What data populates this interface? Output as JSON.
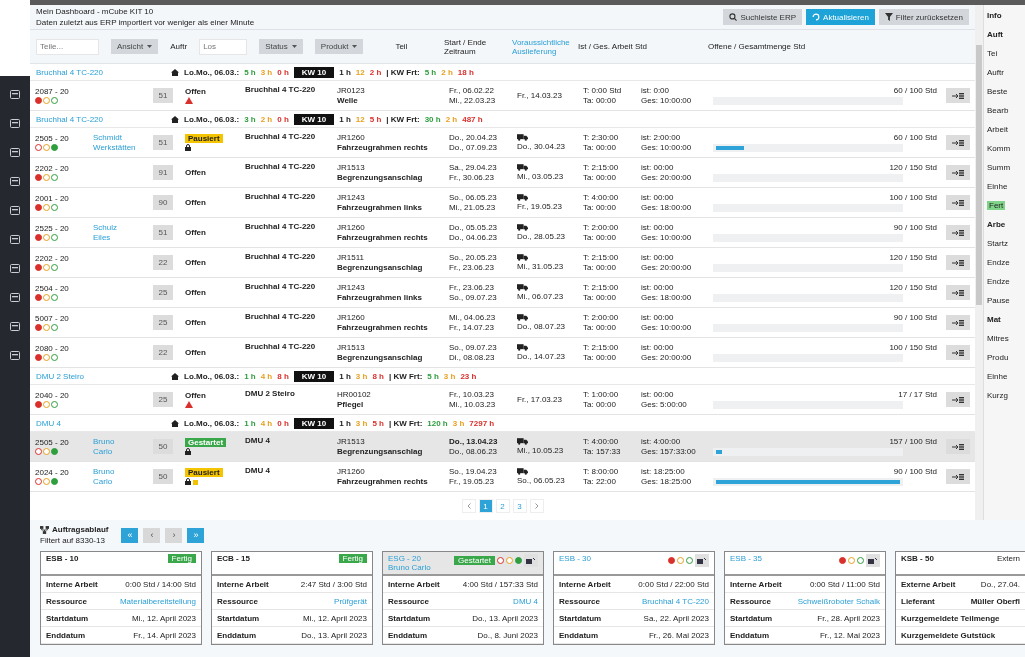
{
  "header": {
    "title": "Mein Dashboard - mCube KIT 10",
    "subtitle": "Daten zuletzt aus ERP importiert vor weniger als einer Minute",
    "buttons": [
      {
        "label": "Suchleiste ERP",
        "kind": "search"
      },
      {
        "label": "Aktualisieren",
        "kind": "primary"
      },
      {
        "label": "Filter zurücksetzen",
        "kind": "filter"
      }
    ]
  },
  "filters": {
    "part": {
      "placeholder": "Teile..."
    },
    "view": "Ansicht",
    "order_label": "Auftr",
    "lot": {
      "placeholder": "Los"
    },
    "status": "Status",
    "product": "Produkt",
    "part_label": "Teil"
  },
  "columns": [
    {
      "label": "Start / Ende Zeitraum",
      "link": false
    },
    {
      "label": "Voraussichtliche Auslieferung",
      "link": true
    },
    {
      "label": "Ist / Ges. Arbeit Std",
      "link": false
    },
    {
      "label": "Offene / Gesamtmenge Std",
      "link": false
    }
  ],
  "groups": [
    {
      "name": "Bruchhal 4 TC-220",
      "segments": [
        {
          "text": "Lo.Mo., 06.03.:",
          "kind": "text"
        },
        {
          "text": "5 h",
          "kind": "ok"
        },
        {
          "text": "3 h",
          "kind": "warn"
        },
        {
          "text": "0 h",
          "kind": "late"
        },
        {
          "text": "KW 10",
          "kind": "chip"
        },
        {
          "text": "1 h",
          "kind": "text"
        },
        {
          "text": "12",
          "kind": "warn"
        },
        {
          "text": "2 h",
          "kind": "late"
        },
        {
          "text": "| KW Frt:",
          "kind": "text"
        },
        {
          "text": "5 h",
          "kind": "ok"
        },
        {
          "text": "2 h",
          "kind": "warn"
        },
        {
          "text": "18 h",
          "kind": "late"
        }
      ],
      "rows": [
        {
          "order": "2087 - 20",
          "lights": [
            {
              "kind": "red",
              "on": true
            },
            {
              "kind": "amber",
              "on": false
            },
            {
              "kind": "green",
              "on": false
            }
          ],
          "qty": "51",
          "status": {
            "kind": "open",
            "text": "Offen"
          },
          "alert": {
            "kind": "warning"
          },
          "machine": "Bruchhal 4 TC-220",
          "code": "JR0123",
          "article": "Welle",
          "start": "Fr., 06.02.22",
          "end": "Mi., 22.03.23",
          "truck": false,
          "delivery": "Fr., 14.03.23",
          "work": [
            "T: 0:00 Std",
            "Ta: 00:00"
          ],
          "qty_time": [
            "ist: 0:00",
            "Ges: 10:00:00"
          ],
          "level": 0,
          "hours": "60 / 100 Std",
          "selected": false
        }
      ]
    },
    {
      "name": "Bruchhal 4 TC-220",
      "segments": [
        {
          "text": "Lo.Mo., 06.03.:",
          "kind": "text"
        },
        {
          "text": "3 h",
          "kind": "ok"
        },
        {
          "text": "2 h",
          "kind": "warn"
        },
        {
          "text": "0 h",
          "kind": "late"
        },
        {
          "text": "KW 10",
          "kind": "chip"
        },
        {
          "text": "1 h",
          "kind": "text"
        },
        {
          "text": "12",
          "kind": "warn"
        },
        {
          "text": "5 h",
          "kind": "late"
        },
        {
          "text": "| KW Frt:",
          "kind": "text"
        },
        {
          "text": "30 h",
          "kind": "ok"
        },
        {
          "text": "2 h",
          "kind": "warn"
        },
        {
          "text": "487 h",
          "kind": "late"
        }
      ],
      "rows": [
        {
          "order": "2505 - 20",
          "lights": [
            {
              "kind": "red",
              "on": false
            },
            {
              "kind": "amber",
              "on": false
            },
            {
              "kind": "green",
              "on": true
            }
          ],
          "customer": [
            "Schmidt",
            "Werkstätten"
          ],
          "qty": "51",
          "status": {
            "kind": "paused",
            "text": "Pausiert"
          },
          "alert": {
            "kind": "lock"
          },
          "machine": "Bruchhal 4 TC-220",
          "code": "JR1260",
          "article": "Fahrzeugrahmen rechts",
          "start": "Do., 20.04.23",
          "end": "Do., 07.09.23",
          "truck": true,
          "delivery": "Do., 30.04.23",
          "work": [
            "T: 2:30:00",
            "Ta: 00:00"
          ],
          "qty_time": [
            "ist: 2:00:00",
            "Ges: 10:00:00"
          ],
          "level": 0.15,
          "hours": "60 / 100 Std",
          "selected": false
        },
        {
          "order": "2202 - 20",
          "lights": [
            {
              "kind": "red",
              "on": true
            },
            {
              "kind": "amber",
              "on": false
            },
            {
              "kind": "green",
              "on": false
            }
          ],
          "qty": "91",
          "status": {
            "kind": "open",
            "text": "Offen"
          },
          "machine": "Bruchhal 4 TC-220",
          "code": "JR1513",
          "article": "Begrenzungsanschlag",
          "start": "Sa., 29.04.23",
          "end": "Fr., 30.06.23",
          "truck": true,
          "delivery": "Mi., 03.05.23",
          "work": [
            "T: 2:15:00",
            "Ta: 00:00"
          ],
          "qty_time": [
            "ist: 00:00",
            "Ges: 20:00:00"
          ],
          "level": 0,
          "hours": "120 / 150 Std",
          "selected": false
        },
        {
          "order": "2001 - 20",
          "lights": [
            {
              "kind": "red",
              "on": true
            },
            {
              "kind": "amber",
              "on": false
            },
            {
              "kind": "green",
              "on": false
            }
          ],
          "qty": "90",
          "status": {
            "kind": "open",
            "text": "Offen"
          },
          "machine": "Bruchhal 4 TC-220",
          "code": "JR1243",
          "article": "Fahrzeugrahmen links",
          "start": "So., 06.05.23",
          "end": "Mi., 21.05.23",
          "truck": true,
          "delivery": "Fr., 19.05.23",
          "work": [
            "T: 4:00:00",
            "Ta: 00:00"
          ],
          "qty_time": [
            "ist: 00:00",
            "Ges: 18:00:00"
          ],
          "level": 0,
          "hours": "100 / 100 Std",
          "selected": false
        },
        {
          "order": "2525 - 20",
          "lights": [
            {
              "kind": "red",
              "on": true
            },
            {
              "kind": "amber",
              "on": false
            },
            {
              "kind": "green",
              "on": false
            }
          ],
          "customer": [
            "Schulz",
            "Eiles"
          ],
          "qty": "51",
          "status": {
            "kind": "open",
            "text": "Offen"
          },
          "machine": "Bruchhal 4 TC-220",
          "code": "JR1260",
          "article": "Fahrzeugrahmen rechts",
          "start": "Do., 05.05.23",
          "end": "Do., 04.06.23",
          "truck": true,
          "delivery": "Do., 28.05.23",
          "work": [
            "T: 2:00:00",
            "Ta: 00:00"
          ],
          "qty_time": [
            "ist: 00:00",
            "Ges: 10:00:00"
          ],
          "level": 0,
          "hours": "90 / 100 Std",
          "selected": false
        },
        {
          "order": "2202 - 20",
          "lights": [
            {
              "kind": "red",
              "on": true
            },
            {
              "kind": "amber",
              "on": false
            },
            {
              "kind": "green",
              "on": false
            }
          ],
          "qty": "22",
          "status": {
            "kind": "open",
            "text": "Offen"
          },
          "machine": "Bruchhal 4 TC-220",
          "code": "JR1511",
          "article": "Begrenzungsanschlag",
          "start": "So., 20.05.23",
          "end": "Fr., 23.06.23",
          "truck": true,
          "delivery": "Mi., 31.05.23",
          "work": [
            "T: 2:15:00",
            "Ta: 00:00"
          ],
          "qty_time": [
            "ist: 00:00",
            "Ges: 20:00:00"
          ],
          "level": 0,
          "hours": "120 / 150 Std",
          "selected": false
        },
        {
          "order": "2504 - 20",
          "lights": [
            {
              "kind": "red",
              "on": true
            },
            {
              "kind": "amber",
              "on": false
            },
            {
              "kind": "green",
              "on": false
            }
          ],
          "qty": "25",
          "status": {
            "kind": "open",
            "text": "Offen"
          },
          "machine": "Bruchhal 4 TC-220",
          "code": "JR1243",
          "article": "Fahrzeugrahmen links",
          "start": "Fr., 23.06.23",
          "end": "So., 09.07.23",
          "truck": true,
          "delivery": "Mi., 06.07.23",
          "work": [
            "T: 2:15:00",
            "Ta: 00:00"
          ],
          "qty_time": [
            "ist: 00:00",
            "Ges: 18:00:00"
          ],
          "level": 0,
          "hours": "120 / 150 Std",
          "selected": false
        },
        {
          "order": "5007 - 20",
          "lights": [
            {
              "kind": "red",
              "on": true
            },
            {
              "kind": "amber",
              "on": false
            },
            {
              "kind": "green",
              "on": false
            }
          ],
          "qty": "25",
          "status": {
            "kind": "open",
            "text": "Offen"
          },
          "machine": "Bruchhal 4 TC-220",
          "code": "JR1260",
          "article": "Fahrzeugrahmen rechts",
          "start": "Mi., 04.06.23",
          "end": "Fr., 14.07.23",
          "truck": true,
          "delivery": "Do., 08.07.23",
          "work": [
            "T: 2:00:00",
            "Ta: 00:00"
          ],
          "qty_time": [
            "ist: 00:00",
            "Ges: 10:00:00"
          ],
          "level": 0,
          "hours": "90 / 100 Std",
          "selected": false
        },
        {
          "order": "2080 - 20",
          "lights": [
            {
              "kind": "red",
              "on": true
            },
            {
              "kind": "amber",
              "on": false
            },
            {
              "kind": "green",
              "on": false
            }
          ],
          "qty": "22",
          "status": {
            "kind": "open",
            "text": "Offen"
          },
          "machine": "Bruchhal 4 TC-220",
          "code": "JR1513",
          "article": "Begrenzungsanschlag",
          "start": "So., 09.07.23",
          "end": "Di., 08.08.23",
          "truck": true,
          "delivery": "Do., 14.07.23",
          "work": [
            "T: 2:15:00",
            "Ta: 00:00"
          ],
          "qty_time": [
            "ist: 00:00",
            "Ges: 20:00:00"
          ],
          "level": 0,
          "hours": "100 / 150 Std",
          "selected": false
        }
      ]
    },
    {
      "name": "DMU 2 Steiro",
      "segments": [
        {
          "text": "Lo.Mo., 06.03.:",
          "kind": "text"
        },
        {
          "text": "1 h",
          "kind": "ok"
        },
        {
          "text": "4 h",
          "kind": "warn"
        },
        {
          "text": "8 h",
          "kind": "late"
        },
        {
          "text": "KW 10",
          "kind": "chip"
        },
        {
          "text": "1 h",
          "kind": "text"
        },
        {
          "text": "3 h",
          "kind": "warn"
        },
        {
          "text": "8 h",
          "kind": "late"
        },
        {
          "text": "| KW Frt:",
          "kind": "text"
        },
        {
          "text": "5 h",
          "kind": "ok"
        },
        {
          "text": "3 h",
          "kind": "warn"
        },
        {
          "text": "23 h",
          "kind": "late"
        }
      ],
      "rows": [
        {
          "order": "2040 - 20",
          "lights": [
            {
              "kind": "red",
              "on": true
            },
            {
              "kind": "amber",
              "on": false
            },
            {
              "kind": "green",
              "on": false
            }
          ],
          "qty": "25",
          "status": {
            "kind": "open",
            "text": "Offen"
          },
          "alert": {
            "kind": "warning"
          },
          "machine": "DMU 2 Steiro",
          "code": "HR00102",
          "article": "Pflegel",
          "start": "Fr., 10.03.23",
          "end": "Mi., 10.03.23",
          "truck": false,
          "delivery": "Fr., 17.03.23",
          "work": [
            "T: 1:00:00",
            "Ta: 00:00"
          ],
          "qty_time": [
            "ist: 00:00",
            "Ges: 5:00:00"
          ],
          "level": 0,
          "hours": "17 / 17 Std",
          "selected": false
        }
      ]
    },
    {
      "name": "DMU 4",
      "segments": [
        {
          "text": "Lo.Mo., 06.03.:",
          "kind": "text"
        },
        {
          "text": "1 h",
          "kind": "ok"
        },
        {
          "text": "4 h",
          "kind": "warn"
        },
        {
          "text": "0 h",
          "kind": "late"
        },
        {
          "text": "KW 10",
          "kind": "chip"
        },
        {
          "text": "1 h",
          "kind": "text"
        },
        {
          "text": "3 h",
          "kind": "warn"
        },
        {
          "text": "5 h",
          "kind": "late"
        },
        {
          "text": "| KW Frt:",
          "kind": "text"
        },
        {
          "text": "120 h",
          "kind": "ok"
        },
        {
          "text": "3 h",
          "kind": "warn"
        },
        {
          "text": "7297 h",
          "kind": "late"
        }
      ],
      "rows": [
        {
          "order": "2505 - 20",
          "lights": [
            {
              "kind": "red",
              "on": false
            },
            {
              "kind": "amber",
              "on": false
            },
            {
              "kind": "green",
              "on": true
            }
          ],
          "customer": [
            "Bruno",
            "Carlo"
          ],
          "qty": "50",
          "status": {
            "kind": "started",
            "text": "Gestartet"
          },
          "alert": {
            "kind": "lock"
          },
          "machine": "DMU 4",
          "code": "JR1513",
          "article": "Begrenzungsanschlag",
          "start": "Do., 13.04.23",
          "end": "Do., 08.06.23",
          "truck": true,
          "delivery": "Mi., 10.05.23",
          "work": [
            "T: 4:00:00",
            "Ta: 157:33"
          ],
          "qty_time": [
            "ist: 4:00:00",
            "Ges: 157:33:00"
          ],
          "level": 0.03,
          "hours": "157 / 100 Std",
          "selected": true
        },
        {
          "order": "2024 - 20",
          "lights": [
            {
              "kind": "red",
              "on": false
            },
            {
              "kind": "amber",
              "on": false
            },
            {
              "kind": "green",
              "on": true
            }
          ],
          "customer": [
            "Bruno",
            "Carlo"
          ],
          "qty": "50",
          "status": {
            "kind": "paused",
            "text": "Pausiert"
          },
          "alert": {
            "kind": "lock-flag"
          },
          "machine": "DMU 4",
          "code": "JR1260",
          "article": "Fahrzeugrahmen rechts",
          "start": "So., 19.04.23",
          "end": "Fr., 19.05.23",
          "truck": true,
          "delivery": "So., 06.05.23",
          "work": [
            "T: 8:00:00",
            "Ta: 22:00"
          ],
          "qty_time": [
            "ist: 18:25:00",
            "Ges: 18:25:00"
          ],
          "level": 1,
          "hours": "90 / 100 Std",
          "selected": false
        }
      ]
    }
  ],
  "pagination": {
    "pages": [
      {
        "label": "1",
        "selected": true
      },
      {
        "label": "2",
        "selected": false
      },
      {
        "label": "3",
        "selected": false
      }
    ]
  },
  "side_panel": {
    "items": [
      {
        "kind": "heading",
        "text": "Info"
      },
      {
        "kind": "heading",
        "text": "Auft"
      },
      {
        "kind": "label",
        "text": "Tei"
      },
      {
        "kind": "label",
        "text": "Auftr"
      },
      {
        "kind": "label",
        "text": "Beste"
      },
      {
        "kind": "label",
        "text": "Bearb"
      },
      {
        "kind": "label",
        "text": "Arbeit"
      },
      {
        "kind": "label",
        "text": "Komm"
      },
      {
        "kind": "label",
        "text": "Summ"
      },
      {
        "kind": "label",
        "text": "Einhe"
      },
      {
        "kind": "badge",
        "text": "Fert"
      },
      {
        "kind": "heading",
        "text": "Arbe"
      },
      {
        "kind": "label",
        "text": "Startz"
      },
      {
        "kind": "label",
        "text": "Endze"
      },
      {
        "kind": "label",
        "text": "Endze"
      },
      {
        "kind": "label",
        "text": "Pause"
      },
      {
        "kind": "heading",
        "text": "Mat"
      },
      {
        "kind": "label",
        "text": "Mitres"
      },
      {
        "kind": "label",
        "text": "Produ"
      },
      {
        "kind": "label",
        "text": "Einhe"
      },
      {
        "kind": "label",
        "text": "Kurzg"
      }
    ]
  },
  "flow": {
    "title": "Auftragsablauf",
    "subtitle": "Filtert auf 8330-13",
    "buttons": [
      {
        "label": "«",
        "kind": "primary"
      },
      {
        "label": "‹",
        "kind": "plain"
      },
      {
        "label": "›",
        "kind": "plain"
      },
      {
        "label": "»",
        "kind": "primary"
      }
    ],
    "cards": [
      {
        "title": "ESB - 10",
        "link": false,
        "badge": "Fertig",
        "action": false,
        "highlight": false,
        "rows": [
          {
            "label": "Interne Arbeit",
            "value": "0:00 Std / 14:00 Std"
          },
          {
            "label": "Ressource",
            "value": "Materialbereitstellung",
            "link": true
          },
          {
            "label": "Startdatum",
            "value": "Mi., 12. April 2023"
          },
          {
            "label": "Enddatum",
            "value": "Fr., 14. April 2023"
          }
        ]
      },
      {
        "title": "ECB - 15",
        "link": false,
        "badge": "Fertig",
        "action": false,
        "highlight": false,
        "rows": [
          {
            "label": "Interne Arbeit",
            "value": "2:47 Std / 3:00 Std"
          },
          {
            "label": "Ressource",
            "value": "Prüfgerät",
            "link": true
          },
          {
            "label": "Startdatum",
            "value": "Mi., 12. April 2023"
          },
          {
            "label": "Enddatum",
            "value": "Do., 13. April 2023"
          }
        ]
      },
      {
        "title": "ESG - 20",
        "link": true,
        "subtitle": "Bruno Carlo",
        "badge": "Gestartet",
        "lights": [
          {
            "kind": "red",
            "on": false
          },
          {
            "kind": "amber",
            "on": false
          },
          {
            "kind": "green",
            "on": true
          }
        ],
        "action": true,
        "highlight": true,
        "rows": [
          {
            "label": "Interne Arbeit",
            "value": "4:00 Std / 157:33 Std"
          },
          {
            "label": "Ressource",
            "value": "DMU 4",
            "link": true
          },
          {
            "label": "Startdatum",
            "value": "Do., 13. April 2023"
          },
          {
            "label": "Enddatum",
            "value": "Do., 8. Juni 2023"
          }
        ]
      },
      {
        "title": "ESB - 30",
        "link": true,
        "lights": [
          {
            "kind": "red",
            "on": true
          },
          {
            "kind": "amber",
            "on": false
          },
          {
            "kind": "green",
            "on": false
          }
        ],
        "action": true,
        "highlight": false,
        "rows": [
          {
            "label": "Interne Arbeit",
            "value": "0:00 Std / 22:00 Std"
          },
          {
            "label": "Ressource",
            "value": "Bruchhal 4 TC-220",
            "link": true
          },
          {
            "label": "Startdatum",
            "value": "Sa., 22. April 2023"
          },
          {
            "label": "Enddatum",
            "value": "Fr., 26. Mai 2023"
          }
        ]
      },
      {
        "title": "ESB - 35",
        "link": true,
        "lights": [
          {
            "kind": "red",
            "on": true
          },
          {
            "kind": "amber",
            "on": false
          },
          {
            "kind": "green",
            "on": false
          }
        ],
        "action": true,
        "highlight": false,
        "rows": [
          {
            "label": "Interne Arbeit",
            "value": "0:00 Std / 11:00 Std"
          },
          {
            "label": "Ressource",
            "value": "Schweißroboter Schalk",
            "link": true
          },
          {
            "label": "Startdatum",
            "value": "Fr., 28. April 2023"
          },
          {
            "label": "Enddatum",
            "value": "Fr., 12. Mai 2023"
          }
        ]
      },
      {
        "title": "KSB - 50",
        "link": false,
        "extra": "Extern",
        "action": false,
        "highlight": false,
        "rows": [
          {
            "label": "Externe Arbeit",
            "value": "Do., 27.04."
          },
          {
            "label": "Lieferant",
            "value": "Müller Oberfl",
            "bold": true
          },
          {
            "label": "Kurzgemeldete Teilmenge"
          },
          {
            "label": "Kurzgemeldete Gutstück"
          }
        ]
      }
    ]
  }
}
